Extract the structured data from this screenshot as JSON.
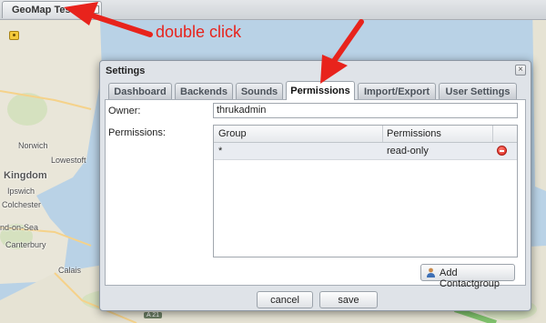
{
  "window": {
    "tab_title": "GeoMap Test"
  },
  "annotation": {
    "text": "double click",
    "color": "#e8231c"
  },
  "map": {
    "labels": [
      "Norwich",
      "Lowestoft",
      "Kingdom",
      "Ipswich",
      "Colchester",
      "nd-on-Sea",
      "Canterbury",
      "Calais"
    ],
    "road": "A 21"
  },
  "dialog": {
    "title": "Settings",
    "close_glyph": "×",
    "tabs": [
      {
        "label": "Dashboard",
        "active": false
      },
      {
        "label": "Backends",
        "active": false
      },
      {
        "label": "Sounds",
        "active": false
      },
      {
        "label": "Permissions",
        "active": true
      },
      {
        "label": "Import/Export",
        "active": false
      },
      {
        "label": "User Settings",
        "active": false
      }
    ],
    "owner_label": "Owner:",
    "owner_value": "thrukadmin",
    "permissions_label": "Permissions:",
    "grid": {
      "columns": [
        "Group",
        "Permissions"
      ],
      "rows": [
        {
          "group": "*",
          "permission": "read-only"
        }
      ]
    },
    "add_button": "Add Contactgroup",
    "cancel_button": "cancel",
    "save_button": "save"
  }
}
